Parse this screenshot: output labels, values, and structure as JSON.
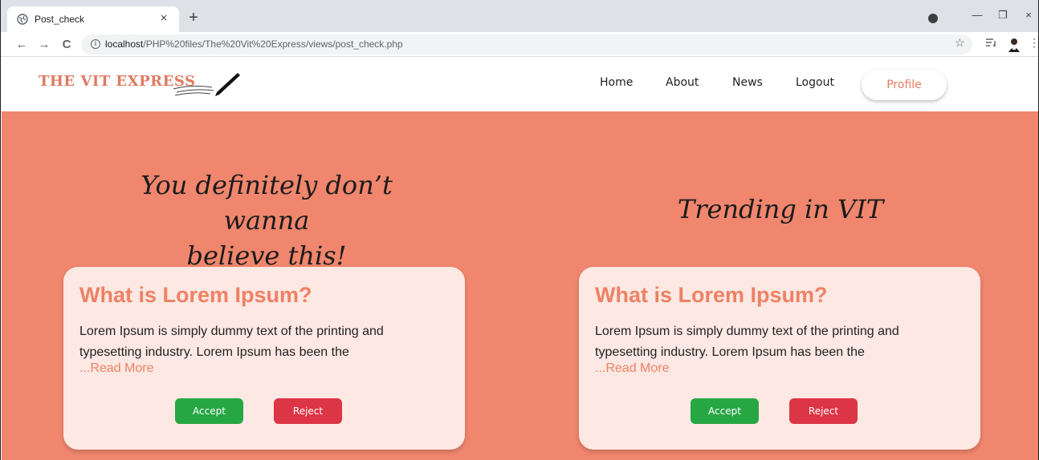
{
  "browser": {
    "tab_title": "Post_check",
    "tab_close": "×",
    "new_tab": "+",
    "back": "←",
    "forward": "→",
    "reload": "C",
    "url_host": "localhost",
    "url_path": "/PHP%20files/The%20Vit%20Express/views/post_check.php",
    "star": "☆",
    "menu": "⋮",
    "minimize": "—",
    "maximize": "❐",
    "close": "×"
  },
  "site": {
    "logo": "THE VIT EXPRESS",
    "nav": [
      "Home",
      "About",
      "News",
      "Logout"
    ],
    "profile": "Profile"
  },
  "sections": [
    {
      "heading_line1": "You definitely don’t wanna",
      "heading_line2": "believe this!",
      "card": {
        "title": "What is Lorem Ipsum?",
        "text": "Lorem Ipsum is simply dummy text of the printing and typesetting industry. Lorem Ipsum has been the",
        "read_more": "...Read More",
        "accept": "Accept",
        "reject": "Reject"
      }
    },
    {
      "heading_line1": "Trending in VIT",
      "card": {
        "title": "What is Lorem Ipsum?",
        "text": "Lorem Ipsum is simply dummy text of the printing and typesetting industry. Lorem Ipsum has been the",
        "read_more": "...Read More",
        "accept": "Accept",
        "reject": "Reject"
      }
    }
  ],
  "colors": {
    "accent": "#f0866d",
    "card_bg": "#fde8e4",
    "accept": "#27a744",
    "reject": "#dc3545"
  }
}
